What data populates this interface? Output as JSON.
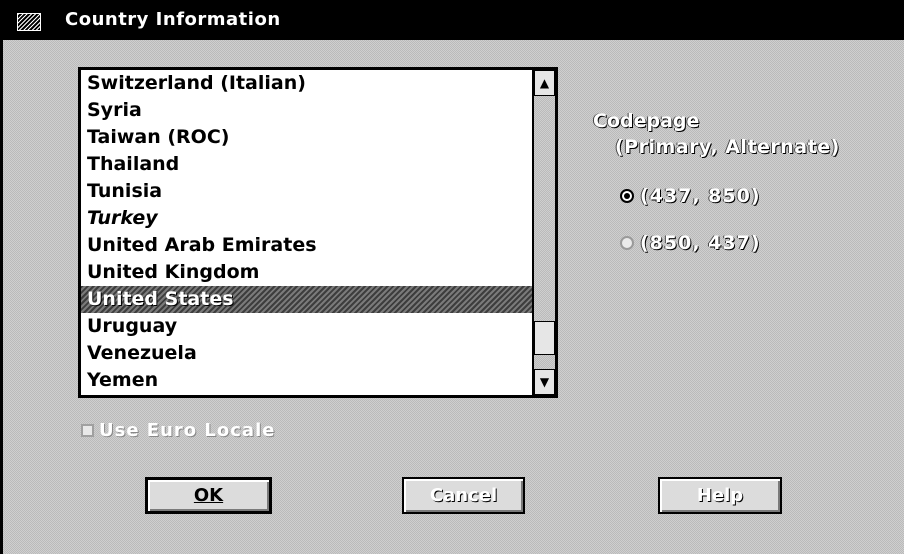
{
  "window": {
    "title": "Country Information"
  },
  "country_list": {
    "items": [
      {
        "label": "Switzerland (Italian)",
        "selected": false,
        "italic": false
      },
      {
        "label": "Syria",
        "selected": false,
        "italic": false
      },
      {
        "label": "Taiwan (ROC)",
        "selected": false,
        "italic": false
      },
      {
        "label": "Thailand",
        "selected": false,
        "italic": false
      },
      {
        "label": "Tunisia",
        "selected": false,
        "italic": false
      },
      {
        "label": "Turkey",
        "selected": false,
        "italic": true
      },
      {
        "label": "United Arab Emirates",
        "selected": false,
        "italic": false
      },
      {
        "label": "United Kingdom",
        "selected": false,
        "italic": false
      },
      {
        "label": "United States",
        "selected": true,
        "italic": false
      },
      {
        "label": "Uruguay",
        "selected": false,
        "italic": false
      },
      {
        "label": "Venezuela",
        "selected": false,
        "italic": false
      },
      {
        "label": "Yemen",
        "selected": false,
        "italic": false
      }
    ],
    "selected_value": "United States",
    "scroll_position": 0.94
  },
  "codepage": {
    "label": "Codepage",
    "sublabel": "(Primary, Alternate)",
    "options": [
      {
        "label": "(437, 850)",
        "checked": true
      },
      {
        "label": "(850, 437)",
        "checked": false
      }
    ]
  },
  "euro_locale": {
    "label": "Use Euro Locale",
    "checked": false
  },
  "buttons": {
    "ok": "OK",
    "cancel": "Cancel",
    "help": "Help"
  },
  "icons": [
    "system-menu-icon",
    "scroll-up-arrow-icon",
    "scroll-down-arrow-icon"
  ]
}
